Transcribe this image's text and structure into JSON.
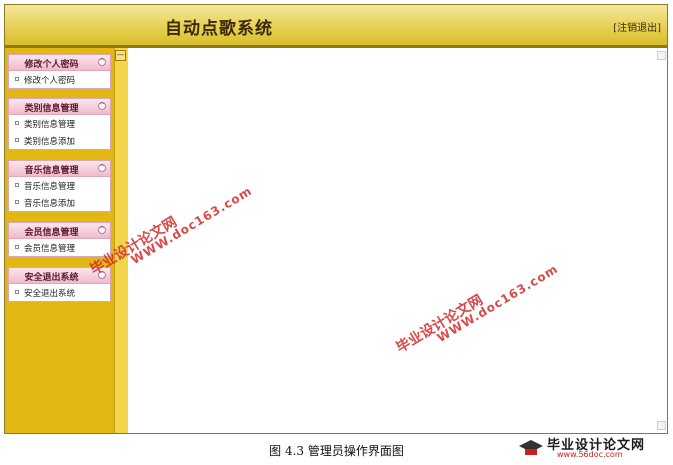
{
  "header": {
    "title": "自动点歌系统",
    "logout_label": "[注销退出]"
  },
  "sidebar": {
    "collapse_glyph": "—",
    "groups": [
      {
        "title": "修改个人密码",
        "items": [
          "修改个人密码"
        ]
      },
      {
        "title": "类别信息管理",
        "items": [
          "类别信息管理",
          "类别信息添加"
        ]
      },
      {
        "title": "音乐信息管理",
        "items": [
          "音乐信息管理",
          "音乐信息添加"
        ]
      },
      {
        "title": "会员信息管理",
        "items": [
          "会员信息管理"
        ]
      },
      {
        "title": "安全退出系统",
        "items": [
          "安全退出系统"
        ]
      }
    ]
  },
  "caption": "图 4.3  管理员操作界面图",
  "watermark": {
    "cn": "毕业设计论文网",
    "en": "WWW.doc163.com"
  },
  "brand": {
    "name": "毕业设计论文网",
    "url": "www.56doc.com"
  },
  "colors": {
    "header": "#e6cf4e",
    "sidebar": "#e2b714",
    "group_header": "#f0b9cc",
    "watermark": "#d42a2a"
  }
}
